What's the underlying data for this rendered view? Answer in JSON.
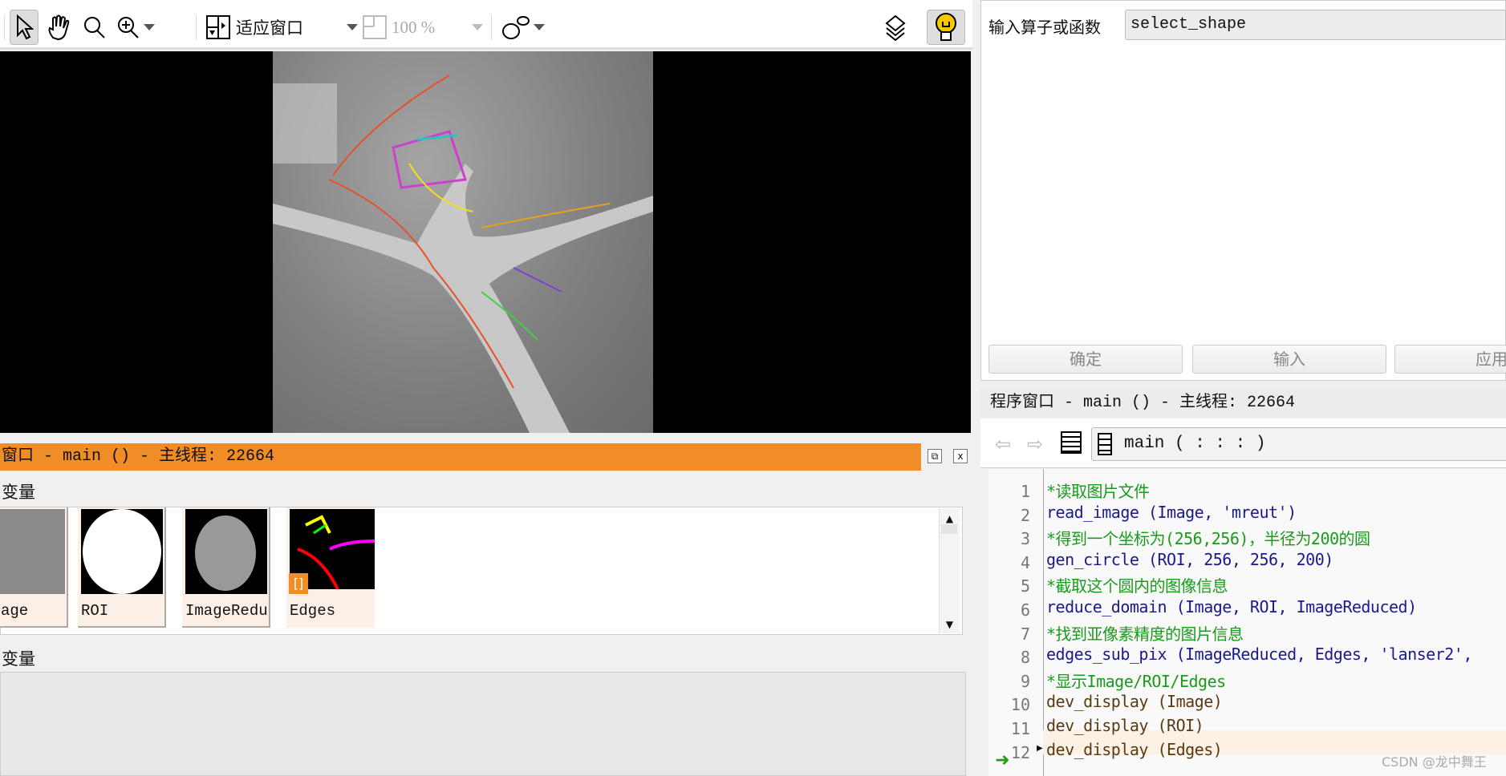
{
  "toolbar": {
    "fit_window": "适应窗口",
    "zoom_level": "100 %",
    "tools": [
      "pointer-icon",
      "hand-icon",
      "magnifier-icon",
      "zoom-in-icon",
      "fit-window-icon",
      "zoom-percent-icon",
      "shape-icon",
      "layers-icon",
      "bulb-icon"
    ]
  },
  "operator": {
    "label": "输入算子或函数",
    "value": "select_shape",
    "buttons": [
      "确定",
      "输入",
      "应用"
    ]
  },
  "program": {
    "title": "程序窗口 - main () - 主线程: 22664",
    "procedure": "main ( : : : )",
    "lines": [
      {
        "n": "1",
        "text": "*读取图片文件",
        "kind": "cmt"
      },
      {
        "n": "2",
        "text": "read_image (Image, 'mreut')",
        "kind": "op"
      },
      {
        "n": "3",
        "text": "*得到一个坐标为(256,256)，半径为200的圆",
        "kind": "cmt"
      },
      {
        "n": "4",
        "text": "gen_circle (ROI, 256, 256, 200)",
        "kind": "op"
      },
      {
        "n": "5",
        "text": "*截取这个圆内的图像信息",
        "kind": "cmt"
      },
      {
        "n": "6",
        "text": "reduce_domain (Image, ROI, ImageReduced)",
        "kind": "op"
      },
      {
        "n": "7",
        "text": "*找到亚像素精度的图片信息",
        "kind": "cmt"
      },
      {
        "n": "8",
        "text": "edges_sub_pix (ImageReduced, Edges, 'lanser2',",
        "kind": "op"
      },
      {
        "n": "9",
        "text": "*显示Image/ROI/Edges",
        "kind": "cmt"
      },
      {
        "n": "10",
        "text": "dev_display (Image)",
        "kind": "dev"
      },
      {
        "n": "11",
        "text": "dev_display (ROI)",
        "kind": "dev"
      },
      {
        "n": "12",
        "text": "dev_display (Edges)",
        "kind": "dev"
      }
    ]
  },
  "variables": {
    "title": "窗口 - main () - 主线程: 22664",
    "icon_vars_label": "变量",
    "control_vars_label": "变量",
    "icons": [
      {
        "name": "age"
      },
      {
        "name": "ROI"
      },
      {
        "name": "ImageRedu"
      },
      {
        "name": "Edges"
      }
    ]
  },
  "watermark": "CSDN @龙中舞王",
  "colors": {
    "accent": "#f08d27",
    "comment": "#1a9a1a",
    "operator": "#1a1a8c"
  }
}
